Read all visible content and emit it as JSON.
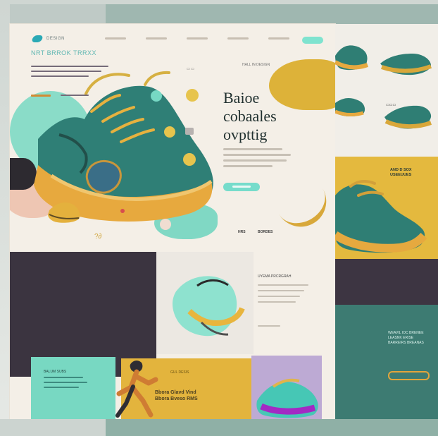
{
  "colors": {
    "teal": "#76d8c4",
    "mustard": "#e3b43d",
    "plum": "#3b3440",
    "forest": "#3d7b72",
    "cream": "#f4efe7"
  },
  "nav": {
    "logo_text": "DESIGN"
  },
  "hero": {
    "kicker": "HALL IN DESIGN",
    "title_line1": "Baioe",
    "title_line2": "cobaales",
    "title_line3": "ovpttig",
    "footer_left": "HRS",
    "footer_right": "BORDES"
  },
  "dark_panel": {
    "title": "NRT BRROK TRRXX"
  },
  "feature": {
    "title": "UYEMA PRCRGRAH"
  },
  "teal_panel": {
    "title": "BALUM SUBS"
  },
  "yellow_panel": {
    "kicker": "GUL DESIS",
    "title_line1": "Bbora Glavd Vind",
    "title_line2": "Bbora  Bveso RMS"
  },
  "right_page": {
    "yellow_title_line1": "AND D SOX",
    "yellow_title_line2": "USEEUUES",
    "green_title_line1": "WEAVIL IOC BRENEE",
    "green_title_line2": "LEASNK ERISE",
    "green_title_line3": "BARREIRS BREANAS"
  }
}
